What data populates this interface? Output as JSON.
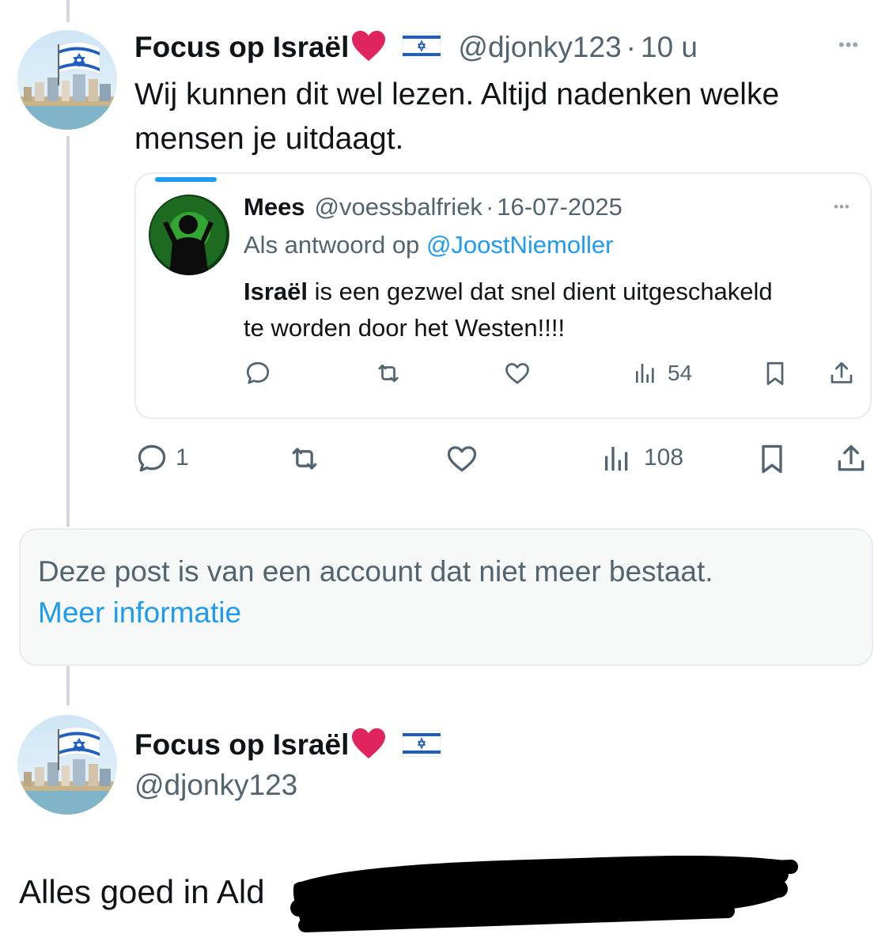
{
  "first_post": {
    "author_name": "Focus op Israël",
    "heart_emoji": "❤️",
    "handle": "@djonky123",
    "separator": "·",
    "time": "10 u",
    "text_line1": "Wij kunnen dit wel lezen. Altijd nadenken welke",
    "text_line2": "mensen je uitdaagt.",
    "more_label": "•••",
    "actions": {
      "reply_count": "1",
      "views_count": "108"
    }
  },
  "quoted_post": {
    "author_name": "Mees",
    "handle": "@voessbalfriek",
    "separator": "·",
    "date": "16-07-2025",
    "reply_prefix": "Als antwoord op",
    "reply_to": "@JoostNiemoller",
    "text_bold": "Israël",
    "text_rest_line1": " is een gezwel dat snel dient uitgeschakeld",
    "text_line2": "te worden door het Westen!!!!",
    "more_label": "•••",
    "actions": {
      "views_count": "54"
    }
  },
  "deleted_notice": {
    "text": "Deze post is van een account dat niet meer bestaat.",
    "link": "Meer informatie"
  },
  "second_post": {
    "author_name": "Focus op Israël",
    "handle": "@djonky123",
    "text_visible": "Alles goed in Ald"
  },
  "colors": {
    "accent_blue": "#1d9bf0",
    "muted_text": "#536471",
    "thread_line": "#cfd9de",
    "heart_red": "#e0245e"
  }
}
